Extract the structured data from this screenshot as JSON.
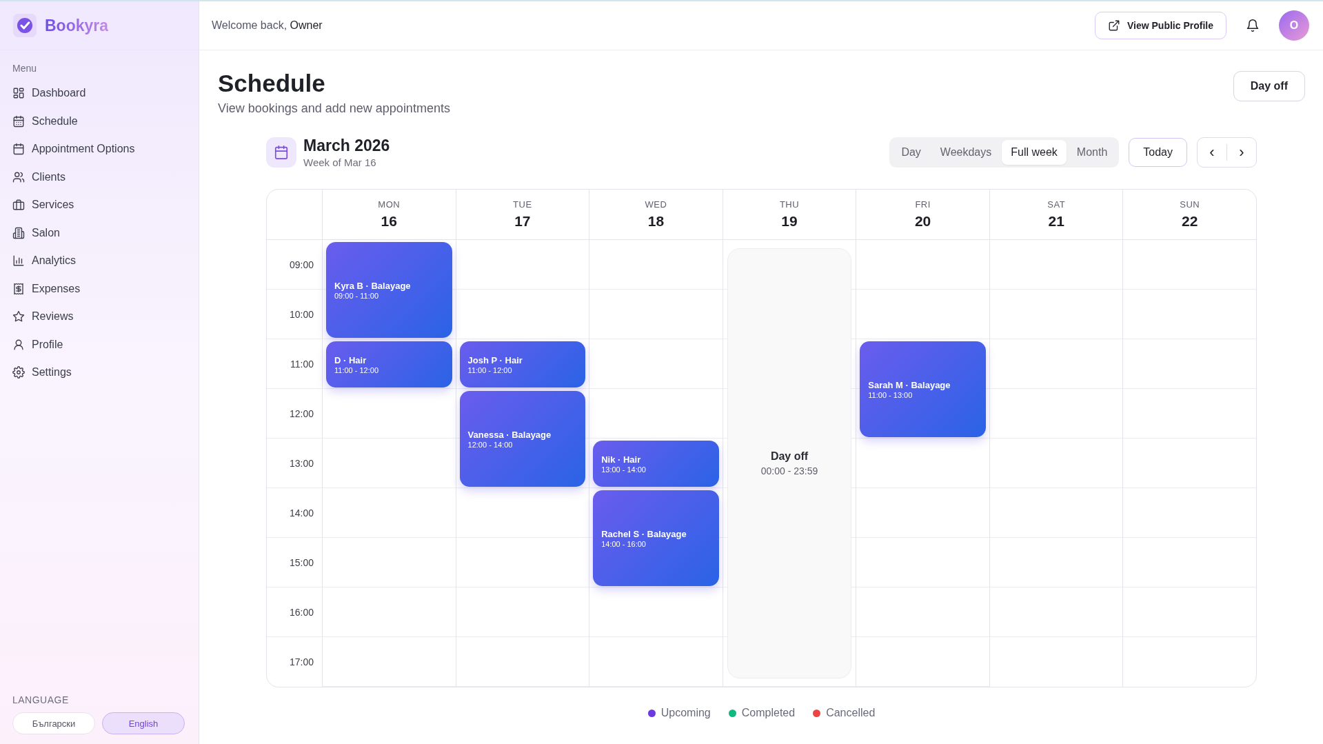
{
  "brand": {
    "name": "Bookyra"
  },
  "sidebar": {
    "menu_label": "Menu",
    "items": [
      {
        "label": "Dashboard"
      },
      {
        "label": "Schedule"
      },
      {
        "label": "Appointment Options"
      },
      {
        "label": "Clients"
      },
      {
        "label": "Services"
      },
      {
        "label": "Salon"
      },
      {
        "label": "Analytics"
      },
      {
        "label": "Expenses"
      },
      {
        "label": "Reviews"
      },
      {
        "label": "Profile"
      },
      {
        "label": "Settings"
      }
    ],
    "language": {
      "label": "LANGUAGE",
      "options": [
        {
          "label": "Български",
          "selected": false
        },
        {
          "label": "English",
          "selected": true
        }
      ]
    }
  },
  "header": {
    "welcome": "Welcome back, **Owner**",
    "public_profile_button": "View Public Profile",
    "avatar": "O"
  },
  "page": {
    "title": "Schedule",
    "subtitle": "View bookings and add new appointments",
    "day_off_button": "Day off"
  },
  "calendar": {
    "month": "March 2026",
    "week": "Week of Mar 16",
    "views": [
      {
        "label": "Day",
        "selected": false
      },
      {
        "label": "Weekdays",
        "selected": false
      },
      {
        "label": "Full week",
        "selected": true
      },
      {
        "label": "Month",
        "selected": false
      }
    ],
    "today_button": "Today",
    "prev_button": "‹",
    "next_button": "›",
    "hours": [
      "09:00",
      "10:00",
      "11:00",
      "12:00",
      "13:00",
      "14:00",
      "15:00",
      "16:00",
      "17:00"
    ],
    "days": [
      {
        "weekday": "MON",
        "date": "16",
        "events": [
          {
            "title": "Kyra B · Balayage",
            "time": "09:00 - 11:00"
          },
          {
            "title": "D · Hair",
            "time": "11:00 - 12:00"
          }
        ]
      },
      {
        "weekday": "TUE",
        "date": "17",
        "events": [
          {
            "title": "Josh P · Hair",
            "time": "11:00 - 12:00"
          },
          {
            "title": "Vanessa · Balayage",
            "time": "12:00 - 14:00"
          }
        ]
      },
      {
        "weekday": "WED",
        "date": "18",
        "events": [
          {
            "title": "Nik · Hair",
            "time": "13:00 - 14:00"
          },
          {
            "title": "Rachel S · Balayage",
            "time": "14:00 - 16:00"
          }
        ]
      },
      {
        "weekday": "THU",
        "date": "19",
        "day_off": {
          "label": "Day off",
          "time": "00:00 - 23:59"
        }
      },
      {
        "weekday": "FRI",
        "date": "20",
        "events": [
          {
            "title": "Sarah M · Balayage",
            "time": "11:00 - 13:00"
          }
        ]
      },
      {
        "weekday": "SAT",
        "date": "21"
      },
      {
        "weekday": "SUN",
        "date": "22"
      }
    ],
    "legend": [
      {
        "label": "Upcoming",
        "color": "#6d3ae0"
      },
      {
        "label": "Completed",
        "color": "#10b981"
      },
      {
        "label": "Cancelled",
        "color": "#ef4444"
      }
    ]
  }
}
